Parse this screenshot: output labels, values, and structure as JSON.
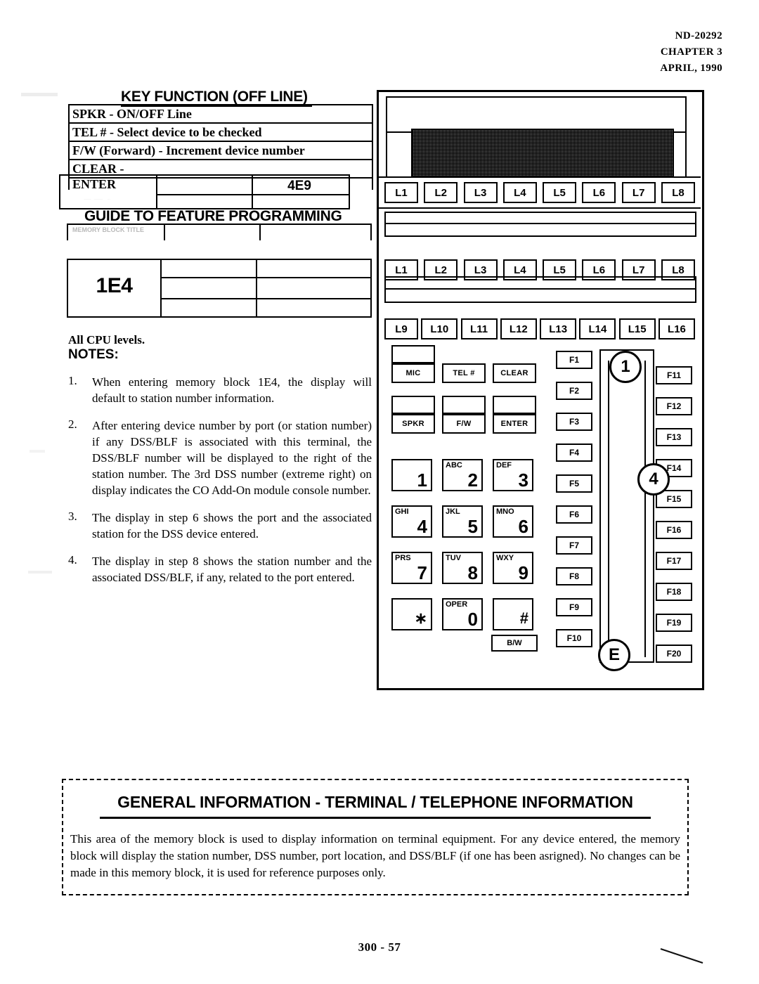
{
  "header": {
    "doc_number": "ND-20292",
    "chapter": "CHAPTER 3",
    "date": "APRIL, 1990"
  },
  "key_function": {
    "title": "KEY FUNCTION (OFF LINE)",
    "rows": [
      "SPKR - ON/OFF Line",
      "TEL # - Select device to be checked",
      "F/W (Forward) - Increment device number",
      "CLEAR -",
      "ENTER"
    ]
  },
  "memory_strip": {
    "code": "4E9",
    "ghost_code": "1E3"
  },
  "guide": {
    "title": "GUIDE TO FEATURE PROGRAMMING",
    "ghost_header": "MEMORY BLOCK TITLE"
  },
  "memory_block": {
    "code": "1E4"
  },
  "notes_section": {
    "cpu_line": "All CPU levels.",
    "heading": "NOTES:",
    "items": [
      {
        "num": "1.",
        "text": "When entering memory block 1E4, the display will default to station number information."
      },
      {
        "num": "2.",
        "text": "After entering device number by port (or station number) if any DSS/BLF is associated with this terminal, the DSS/BLF number will be displayed to the right of the station number. The 3rd DSS number (extreme right) on display indicates the CO Add-On module console number."
      },
      {
        "num": "3.",
        "text": "The display in step 6 shows the port and the associated station for the DSS device entered."
      },
      {
        "num": "4.",
        "text": "The display in step 8 shows the station number and the associated DSS/BLF, if any, related to the port entered."
      }
    ]
  },
  "phone": {
    "line_keys_row1": [
      "L1",
      "L2",
      "L3",
      "L4",
      "L5",
      "L6",
      "L7",
      "L8"
    ],
    "line_keys_row2": [
      "L1",
      "L2",
      "L3",
      "L4",
      "L5",
      "L6",
      "L7",
      "L8"
    ],
    "line_keys_row3": [
      "L9",
      "L10",
      "L11",
      "L12",
      "L13",
      "L14",
      "L15",
      "L16"
    ],
    "feature_buttons": [
      "MIC",
      "TEL #",
      "CLEAR",
      "SPKR",
      "F/W",
      "ENTER"
    ],
    "keypad": [
      {
        "letters": "",
        "digit": "1"
      },
      {
        "letters": "ABC",
        "digit": "2"
      },
      {
        "letters": "DEF",
        "digit": "3"
      },
      {
        "letters": "GHI",
        "digit": "4"
      },
      {
        "letters": "JKL",
        "digit": "5"
      },
      {
        "letters": "MNO",
        "digit": "6"
      },
      {
        "letters": "PRS",
        "digit": "7"
      },
      {
        "letters": "TUV",
        "digit": "8"
      },
      {
        "letters": "WXY",
        "digit": "9"
      },
      {
        "letters": "",
        "digit": "∗"
      },
      {
        "letters": "OPER",
        "digit": "0"
      },
      {
        "letters": "",
        "digit": "#"
      }
    ],
    "bw_button": "B/W",
    "fkeys_left": [
      "F1",
      "F2",
      "F3",
      "F4",
      "F5",
      "F6",
      "F7",
      "F8",
      "F9",
      "F10"
    ],
    "fkeys_right": [
      "F11",
      "F12",
      "F13",
      "F14",
      "F15",
      "F16",
      "F17",
      "F18",
      "F19",
      "F20"
    ],
    "callouts": [
      "1",
      "4",
      "E"
    ]
  },
  "general_info": {
    "title": "GENERAL INFORMATION  -  TERMINAL / TELEPHONE INFORMATION",
    "body": "This area of the memory block is used to display information on terminal equipment.  For any device entered, the memory block will display the station number, DSS number, port location, and DSS/BLF  (if one has been asrigned).  No changes can be made in this memory block, it is used for reference purposes only."
  },
  "footer": {
    "page": "300 - 57"
  }
}
